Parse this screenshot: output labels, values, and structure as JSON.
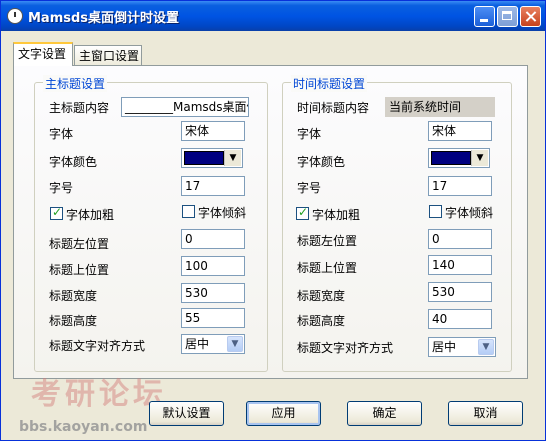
{
  "window": {
    "title": "Mamsds桌面倒计时设置"
  },
  "tabs": [
    {
      "label": "文字设置"
    },
    {
      "label": "主窗口设置"
    }
  ],
  "main_group": {
    "title": "主标题设置",
    "content_label": "主标题内容",
    "content_value": "________Mamsds桌面倒计",
    "font_label": "字体",
    "font_value": "宋体",
    "color_label": "字体颜色",
    "color_hex": "#000080",
    "size_label": "字号",
    "size_value": "17",
    "bold_label": "字体加粗",
    "bold_checked": true,
    "italic_label": "字体倾斜",
    "italic_checked": false,
    "left_label": "标题左位置",
    "left_value": "0",
    "top_label": "标题上位置",
    "top_value": "100",
    "width_label": "标题宽度",
    "width_value": "530",
    "height_label": "标题高度",
    "height_value": "55",
    "align_label": "标题文字对齐方式",
    "align_value": "居中"
  },
  "time_group": {
    "title": "时间标题设置",
    "content_label": "时间标题内容",
    "content_value": "当前系统时间",
    "font_label": "字体",
    "font_value": "宋体",
    "color_label": "字体颜色",
    "color_hex": "#000080",
    "size_label": "字号",
    "size_value": "17",
    "bold_label": "字体加粗",
    "bold_checked": true,
    "italic_label": "字体倾斜",
    "italic_checked": false,
    "left_label": "标题左位置",
    "left_value": "0",
    "top_label": "标题上位置",
    "top_value": "140",
    "width_label": "标题宽度",
    "width_value": "530",
    "height_label": "标题高度",
    "height_value": "40",
    "align_label": "标题文字对齐方式",
    "align_value": "居中"
  },
  "buttons": {
    "default": "默认设置",
    "apply": "应用",
    "ok": "确定",
    "cancel": "取消"
  },
  "watermark": {
    "main": "考研论坛",
    "url": "bbs.kaoyan.com"
  }
}
